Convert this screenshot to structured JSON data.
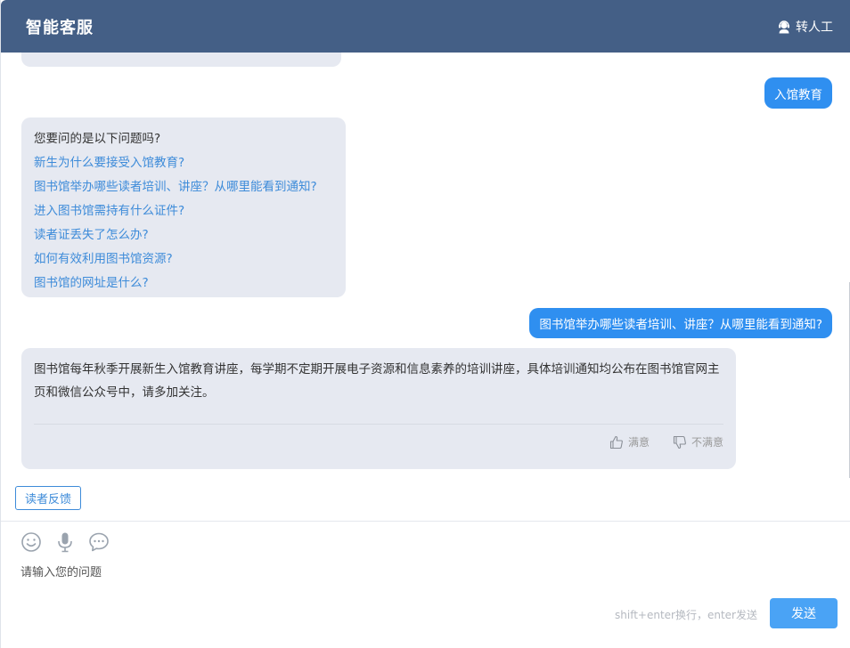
{
  "header": {
    "title": "智能客服",
    "transfer_label": "转人工",
    "transfer_icon": "customer-service-headset-icon"
  },
  "messages": {
    "user_1": "入馆教育",
    "suggest": {
      "intro": "您要问的是以下问题吗?",
      "questions": [
        "新生为什么要接受入馆教育?",
        "图书馆举办哪些读者培训、讲座？从哪里能看到通知?",
        "进入图书馆需持有什么证件?",
        "读者证丢失了怎么办?",
        "如何有效利用图书馆资源?",
        "图书馆的网址是什么?"
      ]
    },
    "user_2": "图书馆举办哪些读者培训、讲座？从哪里能看到通知?",
    "answer": {
      "text": "图书馆每年秋季开展新生入馆教育讲座，每学期不定期开展电子资源和信息素养的培训讲座，具体培训通知均公布在图书馆官网主页和微信公众号中，请多加关注。",
      "satisfied_label": "满意",
      "unsatisfied_label": "不满意"
    }
  },
  "reader_feedback_label": "读者反馈",
  "input": {
    "placeholder": "请输入您的问题",
    "hint": "shift+enter换行，enter发送",
    "send_label": "发送",
    "tools": [
      "emoji-icon",
      "microphone-icon",
      "chat-bubble-icon"
    ]
  },
  "colors": {
    "header_bg": "#445f86",
    "user_bubble": "#2f8ff0",
    "bot_bubble": "#e6e9f1",
    "link": "#3d8bd9",
    "send_button": "#4aa3f5"
  }
}
